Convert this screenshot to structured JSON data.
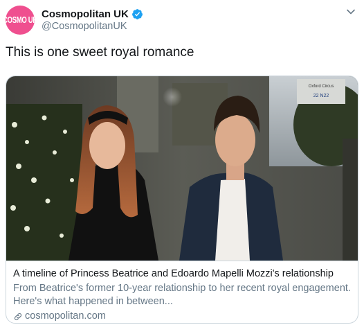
{
  "tweet": {
    "author": {
      "avatar_text": "COSMO UK",
      "display_name": "Cosmopolitan UK",
      "handle": "@CosmopolitanUK",
      "verified": true
    },
    "text": "This is one sweet royal romance",
    "card": {
      "title": "A timeline of Princess Beatrice and Edoardo Mapelli Mozzi's relationship",
      "description": "From Beatrice's former 10-year relationship to her recent royal engagement. Here's what happened in between...",
      "domain": "cosmopolitan.com",
      "image_alt": "Princess Beatrice and Edoardo Mapelli Mozzi walking together outdoors in the evening",
      "street_sign_text": "Oxford Circus",
      "street_sign_number": "22 N22"
    }
  },
  "colors": {
    "avatar_bg": "#ef4f8f",
    "verified_blue": "#1da1f2",
    "secondary_text": "#657786",
    "border": "#ccd6dd"
  },
  "icons": [
    "verified-badge-icon",
    "caret-down-icon",
    "link-icon"
  ]
}
